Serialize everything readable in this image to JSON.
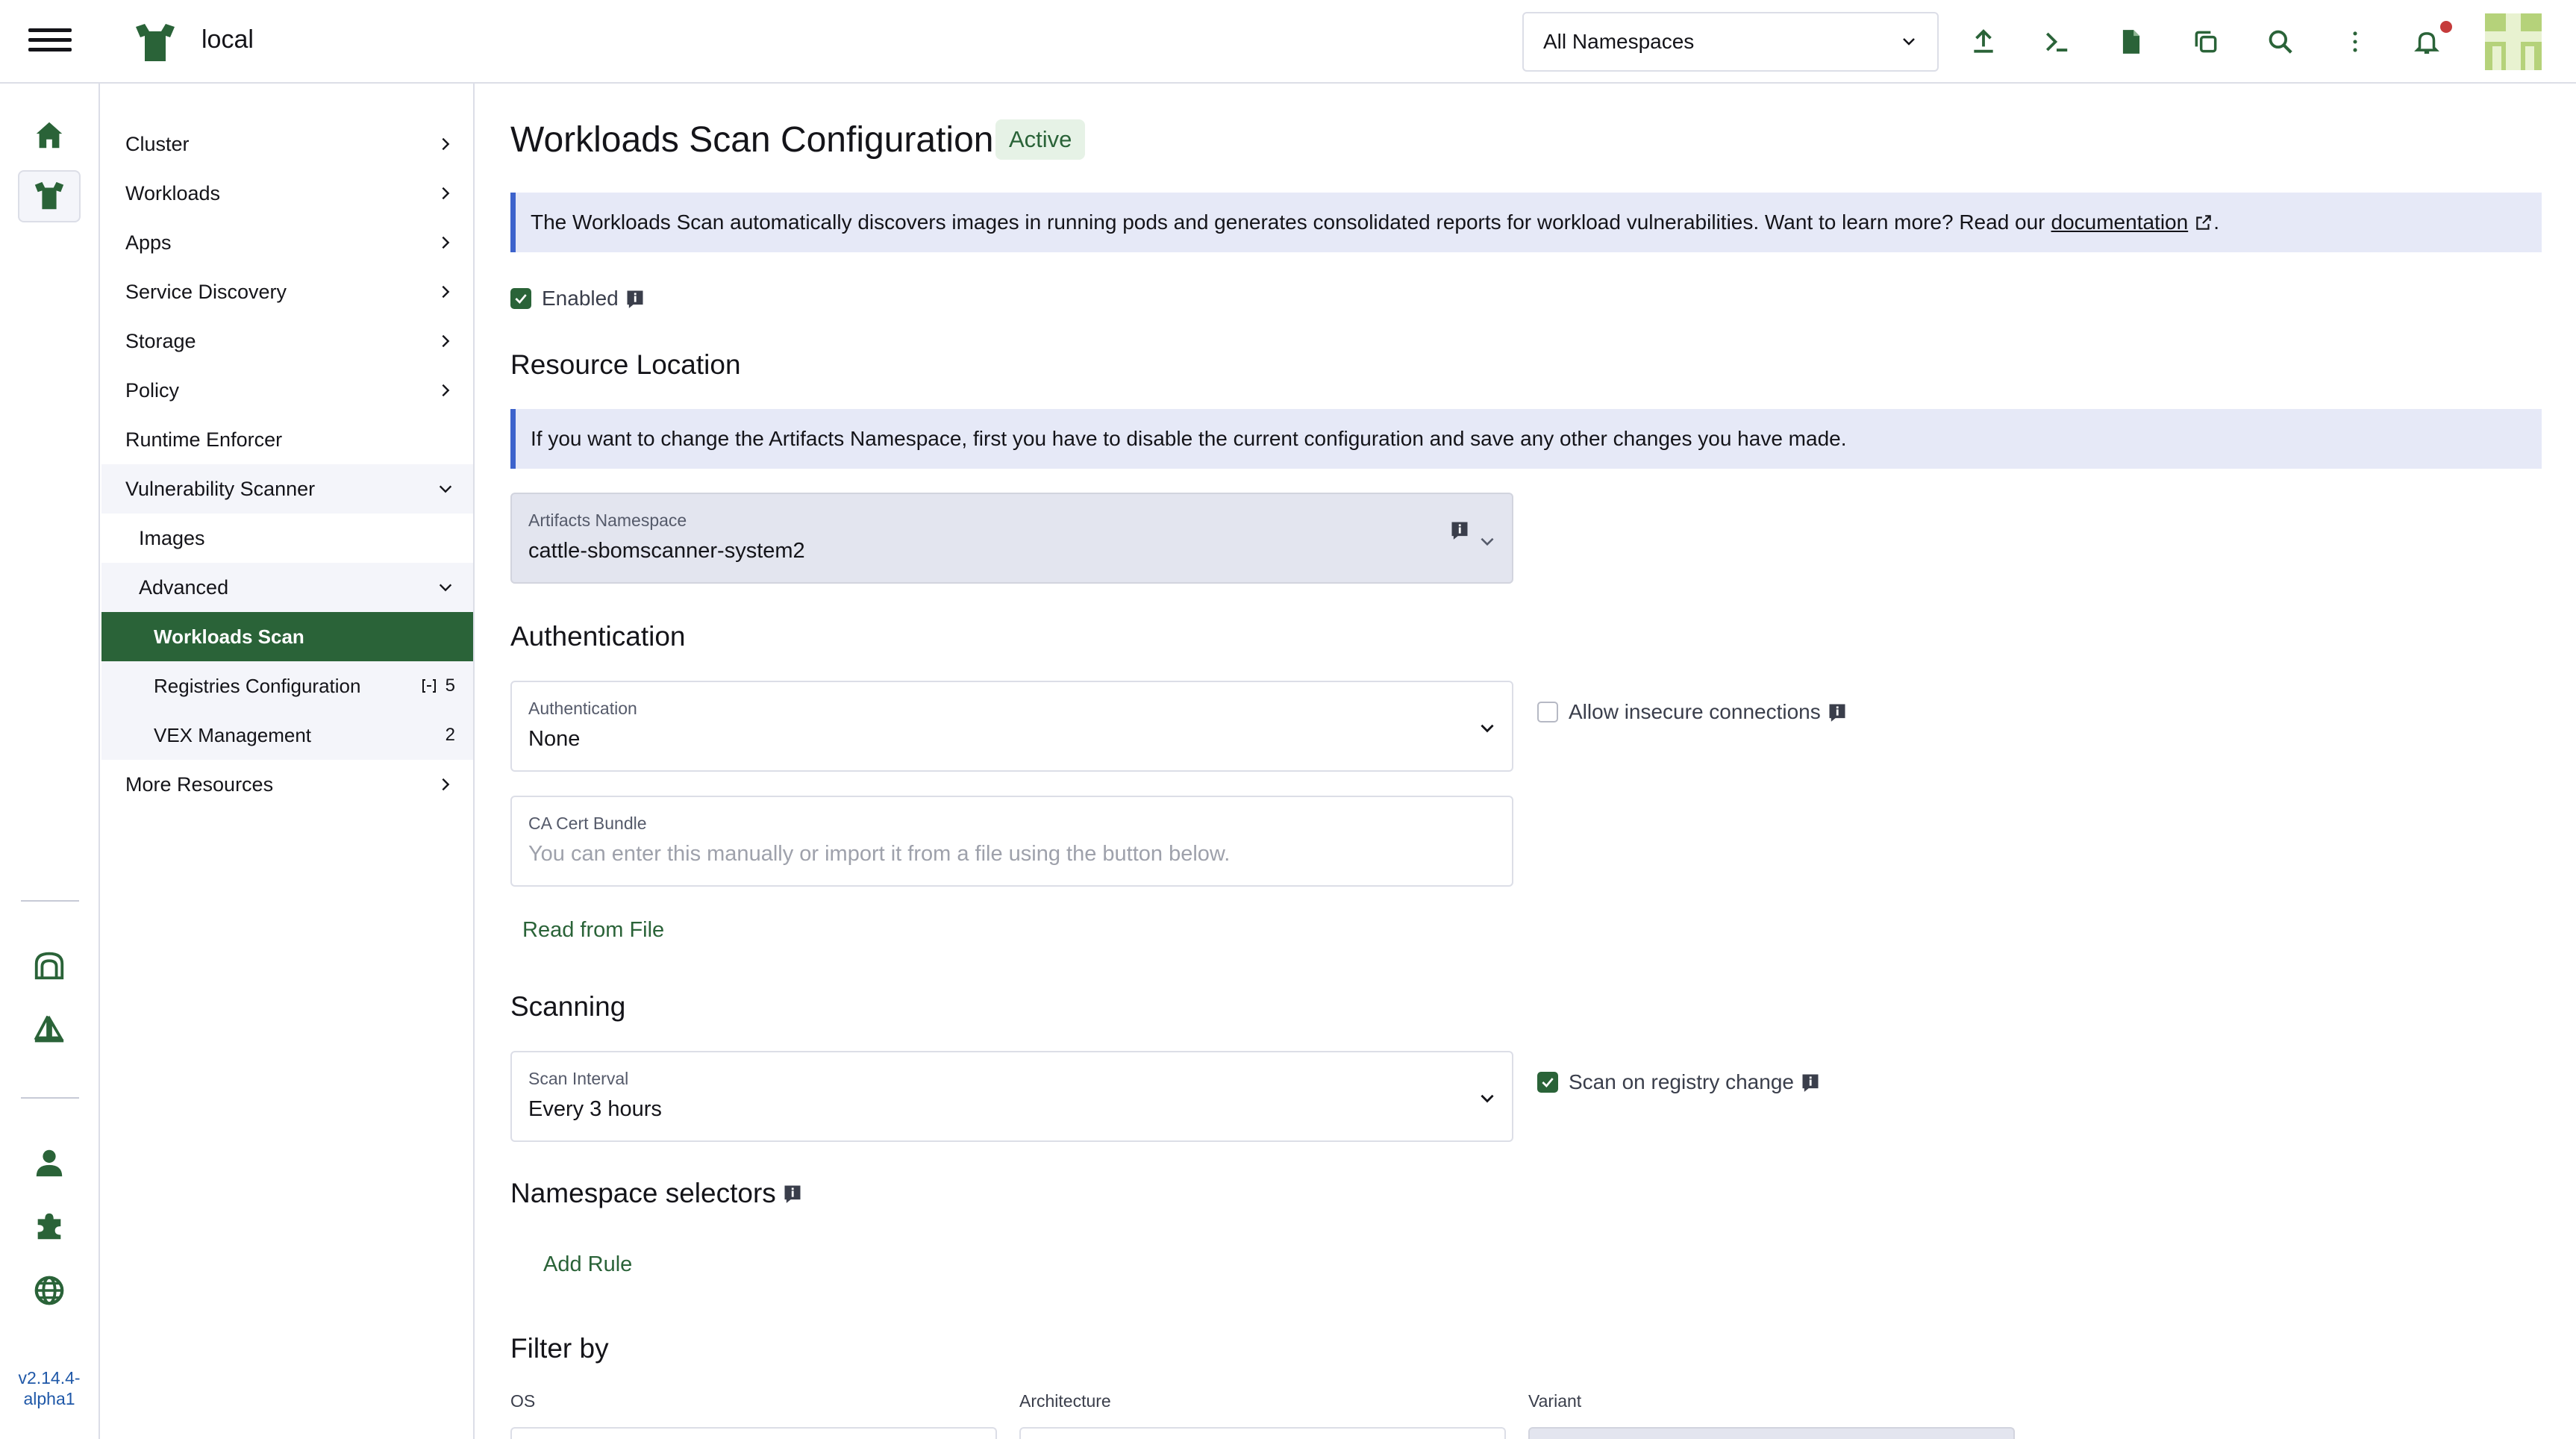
{
  "header": {
    "cluster_name": "local",
    "namespace_filter": "All Namespaces"
  },
  "rail": {
    "version": "v2.14.4-\nalpha1"
  },
  "sidebar": {
    "items": [
      {
        "label": "Cluster"
      },
      {
        "label": "Workloads"
      },
      {
        "label": "Apps"
      },
      {
        "label": "Service Discovery"
      },
      {
        "label": "Storage"
      },
      {
        "label": "Policy"
      },
      {
        "label": "Runtime Enforcer"
      },
      {
        "label": "Vulnerability Scanner"
      },
      {
        "label": "Images"
      },
      {
        "label": "Advanced"
      },
      {
        "label": "Workloads Scan"
      },
      {
        "label": "Registries Configuration",
        "count": "5"
      },
      {
        "label": "VEX Management",
        "count": "2"
      },
      {
        "label": "More Resources"
      }
    ]
  },
  "main": {
    "title": "Workloads Scan Configuration",
    "status": "Active",
    "intro_banner": "The Workloads Scan automatically discovers images in running pods and generates consolidated reports for workload vulnerabilities. Want to learn more? Read our",
    "intro_link": "documentation",
    "enabled_label": "Enabled",
    "resource_location": {
      "title": "Resource Location",
      "banner": "If you want to change the Artifacts Namespace, first you have to disable the current configuration and save any other changes you have made.",
      "artifacts_namespace_label": "Artifacts Namespace",
      "artifacts_namespace_value": "cattle-sbomscanner-system2"
    },
    "authentication": {
      "title": "Authentication",
      "auth_label": "Authentication",
      "auth_value": "None",
      "insecure_label": "Allow insecure connections",
      "ca_label": "CA Cert Bundle",
      "ca_placeholder": "You can enter this manually or import it from a file using the button below.",
      "read_file": "Read from File"
    },
    "scanning": {
      "title": "Scanning",
      "interval_label": "Scan Interval",
      "interval_value": "Every 3 hours",
      "registry_change_label": "Scan on registry change"
    },
    "namespace_selectors": {
      "title": "Namespace selectors",
      "add_rule": "Add Rule"
    },
    "filter": {
      "title": "Filter by",
      "os_label": "OS",
      "arch_label": "Architecture",
      "variant_label": "Variant"
    }
  }
}
